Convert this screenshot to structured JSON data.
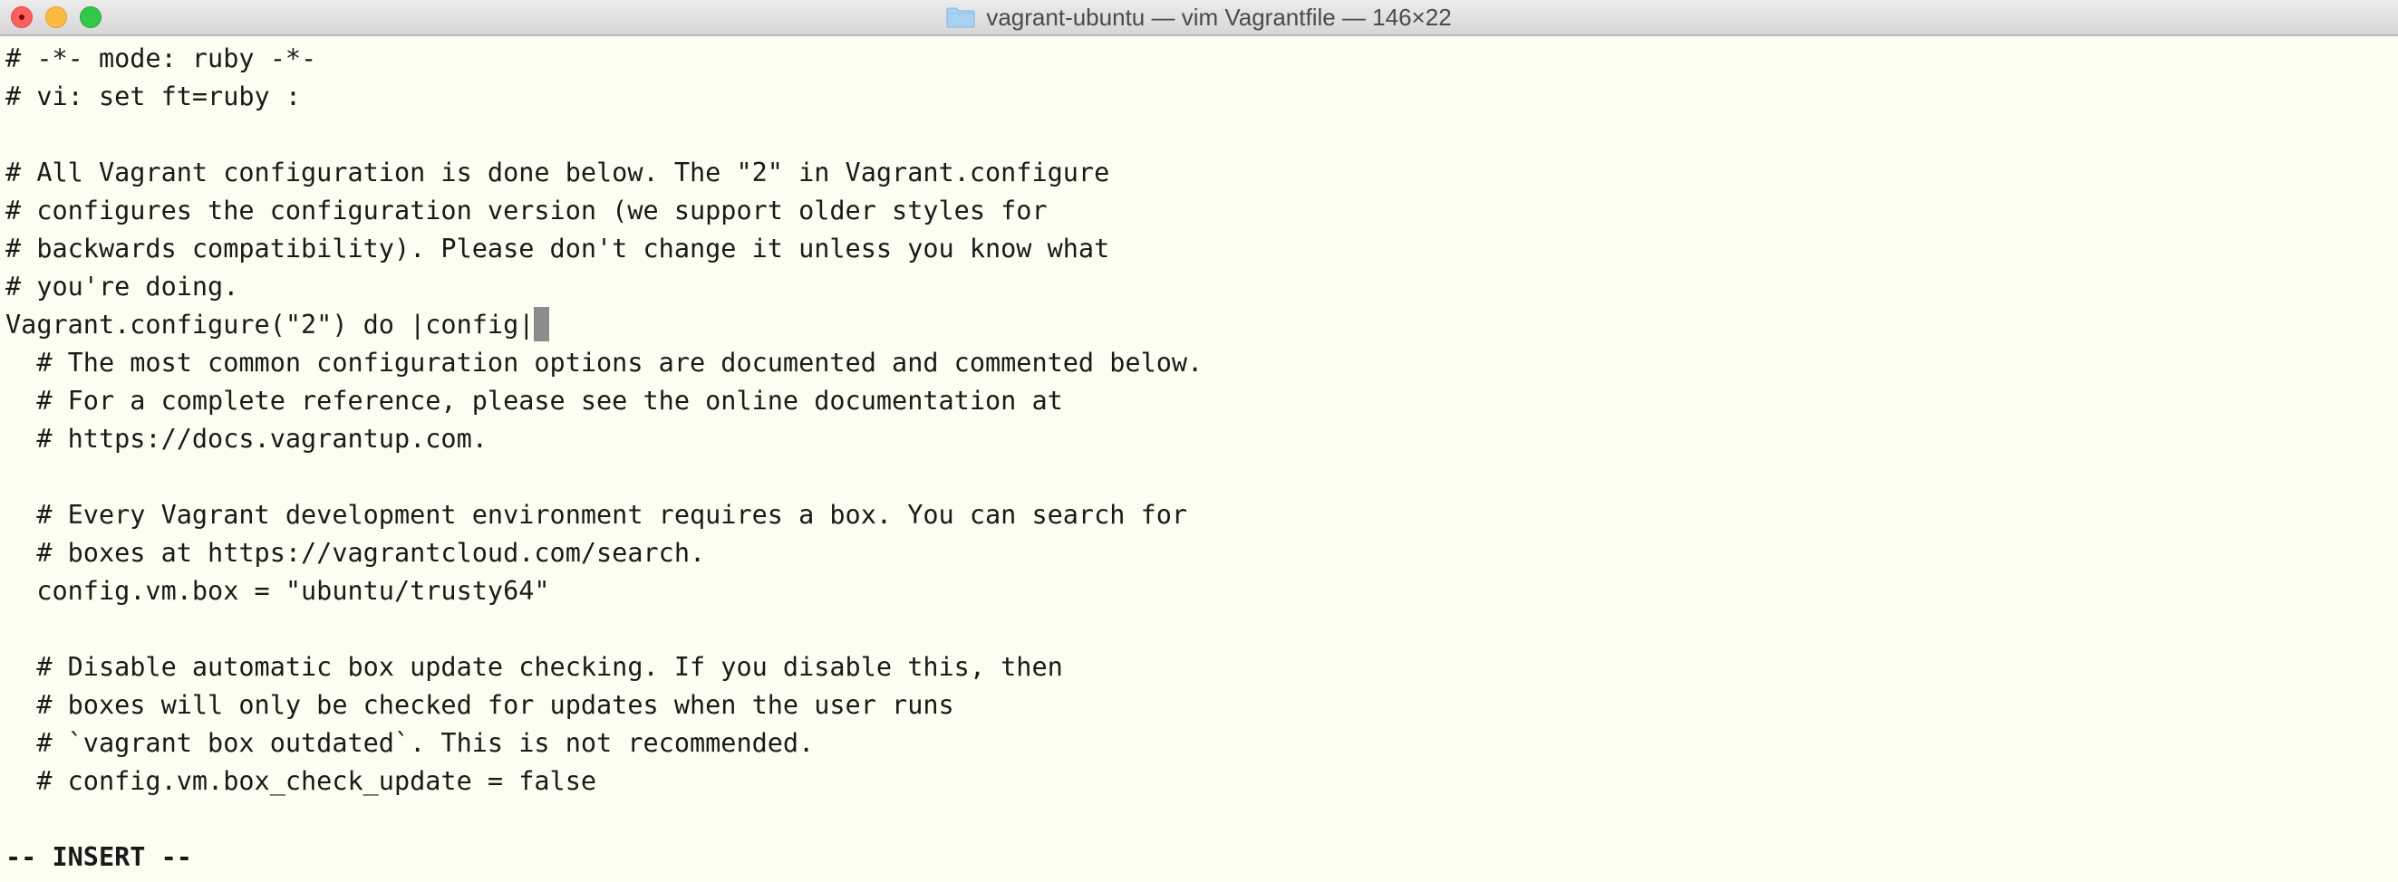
{
  "window": {
    "title": "vagrant-ubuntu — vim Vagrantfile — 146×22"
  },
  "editor": {
    "lines": [
      "# -*- mode: ruby -*-",
      "# vi: set ft=ruby :",
      "",
      "# All Vagrant configuration is done below. The \"2\" in Vagrant.configure",
      "# configures the configuration version (we support older styles for",
      "# backwards compatibility). Please don't change it unless you know what",
      "# you're doing.",
      "Vagrant.configure(\"2\") do |config|",
      "  # The most common configuration options are documented and commented below.",
      "  # For a complete reference, please see the online documentation at",
      "  # https://docs.vagrantup.com.",
      "",
      "  # Every Vagrant development environment requires a box. You can search for",
      "  # boxes at https://vagrantcloud.com/search.",
      "  config.vm.box = \"ubuntu/trusty64\"",
      "",
      "  # Disable automatic box update checking. If you disable this, then",
      "  # boxes will only be checked for updates when the user runs",
      "  # `vagrant box outdated`. This is not recommended.",
      "  # config.vm.box_check_update = false",
      ""
    ],
    "mode": "-- INSERT --"
  }
}
